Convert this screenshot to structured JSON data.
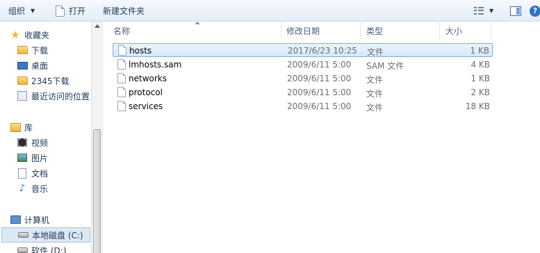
{
  "toolbar": {
    "organize_label": "组织",
    "open_label": "打开",
    "new_folder_label": "新建文件夹"
  },
  "nav": {
    "favorites": "收藏夹",
    "downloads": "下载",
    "desktop": "桌面",
    "downloads_2345": "2345下载",
    "recent_places": "最近访问的位置",
    "libraries": "库",
    "videos": "视频",
    "pictures": "图片",
    "documents": "文档",
    "music": "音乐",
    "computer": "计算机",
    "local_disk_c": "本地磁盘 (C:)",
    "software_d": "软件 (D:)"
  },
  "columns": {
    "name": "名称",
    "date": "修改日期",
    "type": "类型",
    "size": "大小"
  },
  "files": [
    {
      "name": "hosts",
      "date": "2017/6/23 10:25",
      "type": "文件",
      "size": "1 KB"
    },
    {
      "name": "lmhosts.sam",
      "date": "2009/6/11 5:00",
      "type": "SAM 文件",
      "size": "4 KB"
    },
    {
      "name": "networks",
      "date": "2009/6/11 5:00",
      "type": "文件",
      "size": "1 KB"
    },
    {
      "name": "protocol",
      "date": "2009/6/11 5:00",
      "type": "文件",
      "size": "2 KB"
    },
    {
      "name": "services",
      "date": "2009/6/11 5:00",
      "type": "文件",
      "size": "18 KB"
    }
  ],
  "selected_file": "hosts",
  "colors": {
    "selection_border": "#84acdd",
    "selection_fill": "#d8e8fb",
    "text_primary": "#1e395b"
  }
}
